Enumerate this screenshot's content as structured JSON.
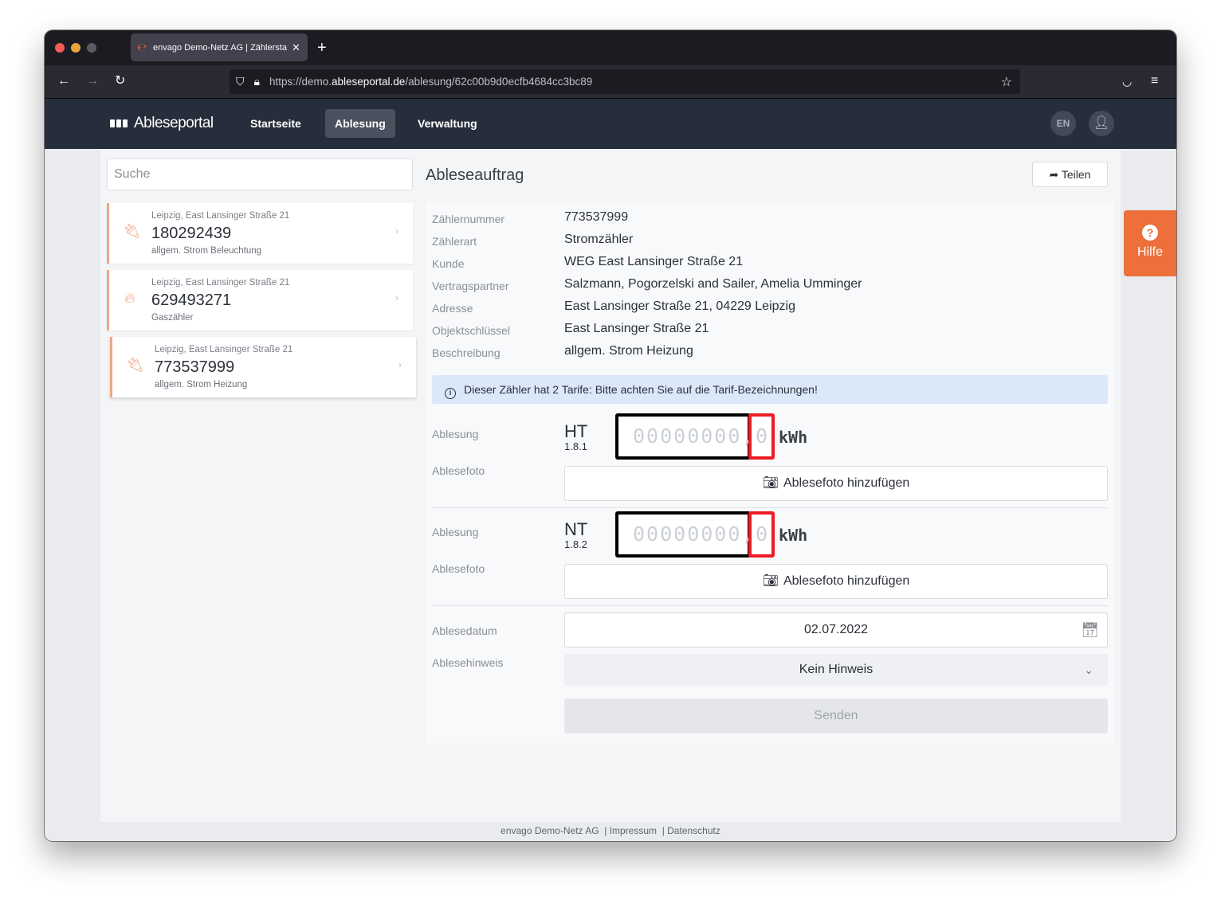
{
  "browser": {
    "tab_title": "envago Demo-Netz AG | Zählerstand",
    "url_prefix": "https://demo.",
    "url_domain": "ableseportal.de",
    "url_path": "/ablesung/62c00b9d0ecfb4684cc3bc89"
  },
  "header": {
    "logo": "Ableseportal",
    "nav": [
      "Startseite",
      "Ablesung",
      "Verwaltung"
    ],
    "active_nav": "Ablesung",
    "lang": "EN"
  },
  "sidebar": {
    "search_placeholder": "Suche",
    "meters": [
      {
        "address": "Leipzig, East Lansinger Straße 21",
        "number": "180292439",
        "description": "allgem. Strom Beleuchtung",
        "icon": "plug-icon"
      },
      {
        "address": "Leipzig, East Lansinger Straße 21",
        "number": "629493271",
        "description": "Gaszähler",
        "icon": "flame-icon"
      },
      {
        "address": "Leipzig, East Lansinger Straße 21",
        "number": "773537999",
        "description": "allgem. Strom Heizung",
        "icon": "plug-icon",
        "selected": true
      }
    ]
  },
  "main": {
    "title": "Ableseauftrag",
    "share_label": "Teilen",
    "details": [
      {
        "label": "Zählernummer",
        "value": "773537999"
      },
      {
        "label": "Zählerart",
        "value": "Stromzähler"
      },
      {
        "label": "Kunde",
        "value": "WEG East Lansinger Straße 21"
      },
      {
        "label": "Vertragspartner",
        "value": "Salzmann, Pogorzelski and Sailer, Amelia Umminger"
      },
      {
        "label": "Adresse",
        "value": "East Lansinger Straße 21, 04229 Leipzig"
      },
      {
        "label": "Objektschlüssel",
        "value": "East Lansinger Straße 21"
      },
      {
        "label": "Beschreibung",
        "value": "allgem. Strom Heizung"
      }
    ],
    "alert": "Dieser Zähler hat 2 Tarife: Bitte achten Sie auf die Tarif-Bezeichnungen!",
    "tariffs": [
      {
        "reading_label": "Ablesung",
        "code": "HT",
        "obis": "1.8.1",
        "digits_placeholder": "00000000,",
        "decimal_placeholder": "0",
        "unit": "kWh",
        "photo_label": "Ablesefoto",
        "photo_button": "Ablesefoto hinzufügen"
      },
      {
        "reading_label": "Ablesung",
        "code": "NT",
        "obis": "1.8.2",
        "digits_placeholder": "00000000,",
        "decimal_placeholder": "0",
        "unit": "kWh",
        "photo_label": "Ablesefoto",
        "photo_button": "Ablesefoto hinzufügen"
      }
    ],
    "date_label": "Ablesedatum",
    "date_value": "02.07.2022",
    "hint_label": "Ablesehinweis",
    "hint_value": "Kein Hinweis",
    "send_label": "Senden"
  },
  "help": {
    "label": "Hilfe"
  },
  "footer": {
    "company": "envago Demo-Netz AG",
    "imprint": "| Impressum",
    "privacy": "| Datenschutz"
  },
  "colors": {
    "header_bg": "#262d3b",
    "accent": "#ec6f3c",
    "alert_bg": "#dbe8fa",
    "digits_border": "#000000",
    "decimal_border": "#ed1c24"
  }
}
